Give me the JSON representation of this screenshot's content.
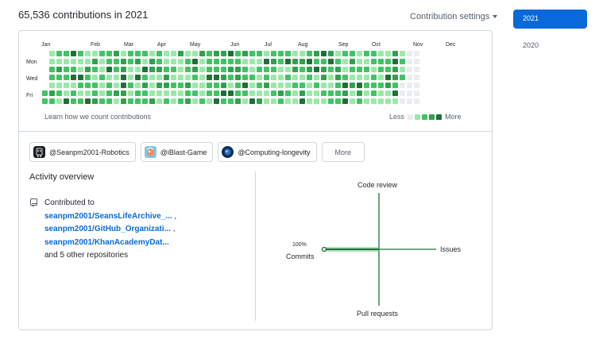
{
  "header": {
    "title": "65,536 contributions in 2021",
    "settings_label": "Contribution settings"
  },
  "graph": {
    "months": [
      "Jan",
      "Feb",
      "Mar",
      "Apr",
      "May",
      "Jun",
      "Jul",
      "Aug",
      "Sep",
      "Oct",
      "Nov",
      "Dec"
    ],
    "days": [
      "Mon",
      "Wed",
      "Fri"
    ],
    "learn_link": "Learn how we count contributions",
    "legend_less": "Less",
    "legend_more": "More",
    "colors": [
      "#ebedf0",
      "#9be9a8",
      "#40c463",
      "#30a14e",
      "#216e39"
    ]
  },
  "organizations": [
    {
      "name": "@Seanpm2001-Robotics",
      "icon": "robotics-avatar"
    },
    {
      "name": "@iBlast-Game",
      "icon": "iblast-avatar"
    },
    {
      "name": "@Computing-longevity",
      "icon": "computing-avatar"
    }
  ],
  "more_label": "More",
  "activity": {
    "title": "Activity overview",
    "contributed_to": "Contributed to",
    "repos": [
      "seanpm2001/SeansLifeArchive_...",
      "seanpm2001/GitHub_Organizati...",
      "seanpm2001/KhanAcademyDat..."
    ],
    "other": "and 5 other repositories"
  },
  "axes": {
    "top": "Code review",
    "right": "Issues",
    "bottom": "Pull requests",
    "left_pct": "100%",
    "left": "Commits"
  },
  "years": [
    "2021",
    "2020"
  ]
}
